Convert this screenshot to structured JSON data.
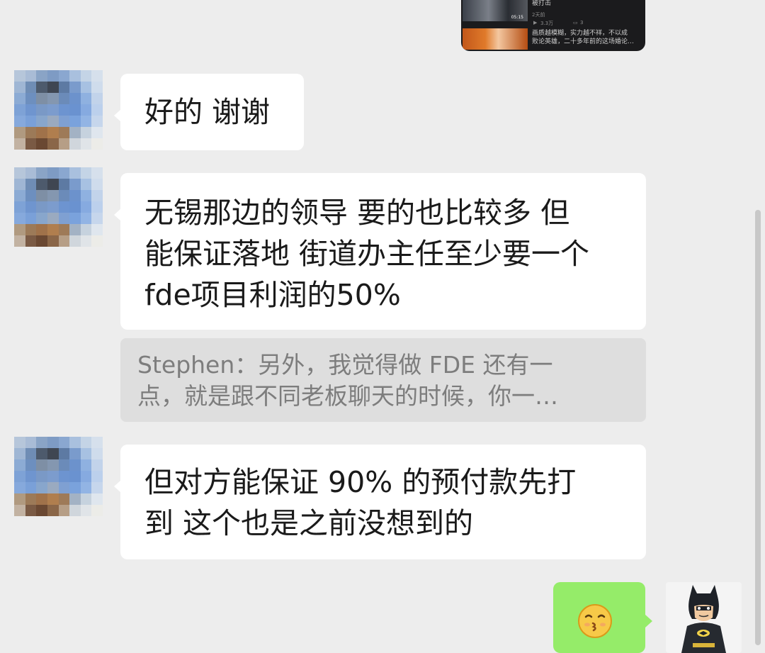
{
  "video_card": {
    "item1_title": "被打击",
    "item1_time": "2天前",
    "item1_views": "3.3万",
    "item1_comments": "3",
    "item1_duration": "05:15",
    "item2_line1": "画质越模糊，实力越不祥，不以成",
    "item2_line2": "败论英雄，二十多年前的这场婚论…"
  },
  "messages": [
    {
      "sender": "other",
      "text": "好的 谢谢"
    },
    {
      "sender": "other",
      "text": "无锡那边的领导 要的也比较多 但\n能保证落地 街道办主任至少要一个\nfde项目利润的50%"
    },
    {
      "sender": "other",
      "text": "但对方能保证 90% 的预付款先打\n到 这个也是之前没想到的"
    },
    {
      "sender": "me",
      "emoji": "kiss-face"
    }
  ],
  "quote": {
    "text": "Stephen：另外，我觉得做 FDE 还有一\n点，就是跟不同老板聊天的时候，你一…"
  },
  "colors": {
    "background": "#ededed",
    "bubble_other": "#ffffff",
    "bubble_me": "#95ec69",
    "quote_bg": "#dedede"
  }
}
